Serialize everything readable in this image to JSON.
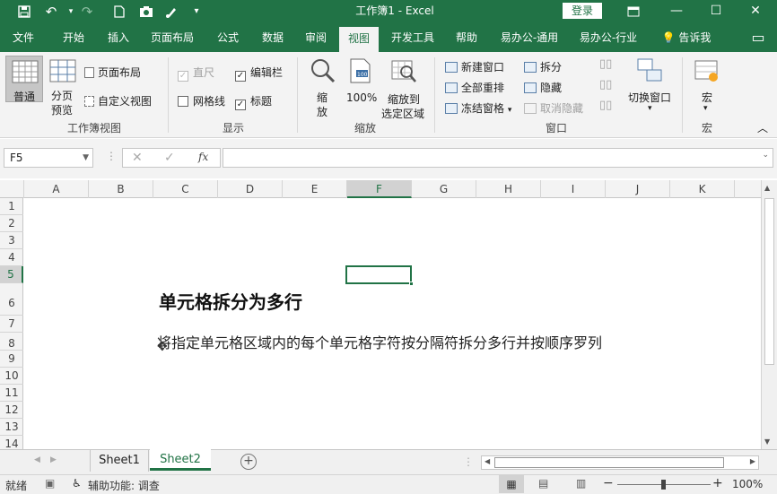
{
  "titlebar": {
    "doc_title": "工作簿1 - Excel",
    "login": "登录",
    "icons": [
      "save-icon",
      "undo-icon",
      "redo-icon",
      "new-file-icon",
      "camera-icon",
      "paint-icon",
      "qat-dropdown-icon"
    ],
    "win_minimize": "—",
    "win_restore": "☐",
    "win_close": "✕"
  },
  "tabs": [
    "文件",
    "开始",
    "插入",
    "页面布局",
    "公式",
    "数据",
    "审阅",
    "视图",
    "开发工具",
    "帮助",
    "易办公-通用",
    "易办公-行业"
  ],
  "active_tab": "视图",
  "tell_me": "告诉我",
  "ribbon": {
    "workbook_views": {
      "label": "工作簿视图",
      "normal": "普通",
      "page_break_line1": "分页",
      "page_break_line2": "预览",
      "page_layout": "页面布局",
      "custom_views": "自定义视图"
    },
    "show": {
      "label": "显示",
      "ruler": "直尺",
      "formula_bar": "编辑栏",
      "gridlines": "网格线",
      "headings": "标题"
    },
    "zoom": {
      "label": "缩放",
      "zoom_line1": "缩",
      "zoom_line2": "放",
      "hundred": "100%",
      "zoom_sel_line1": "缩放到",
      "zoom_sel_line2": "选定区域"
    },
    "window": {
      "label": "窗口",
      "new_window": "新建窗口",
      "arrange_all": "全部重排",
      "freeze_panes": "冻结窗格",
      "split": "拆分",
      "hide": "隐藏",
      "unhide": "取消隐藏",
      "switch_windows": "切换窗口"
    },
    "macros": {
      "label": "宏",
      "macros": "宏"
    }
  },
  "formula_bar": {
    "name_box": "F5",
    "cancel": "✕",
    "enter": "✓",
    "fx": "fx",
    "value": ""
  },
  "columns": [
    "A",
    "B",
    "C",
    "D",
    "E",
    "F",
    "G",
    "H",
    "I",
    "J",
    "K"
  ],
  "selected_column": "F",
  "rows": [
    "1",
    "2",
    "3",
    "4",
    "5",
    "6",
    "7",
    "8",
    "9",
    "10",
    "11",
    "12",
    "13",
    "14"
  ],
  "selected_row": "5",
  "content": {
    "heading": "单元格拆分为多行",
    "description": "将指定单元格区域内的每个单元格字符按分隔符拆分多行并按顺序罗列"
  },
  "sheets": [
    "Sheet1",
    "Sheet2"
  ],
  "active_sheet": "Sheet2",
  "status": {
    "mode": "就绪",
    "accessibility": "辅助功能: 调查",
    "zoom": "100%"
  },
  "colors": {
    "brand": "#217346",
    "ribbon_bg": "#f3f3f3"
  }
}
